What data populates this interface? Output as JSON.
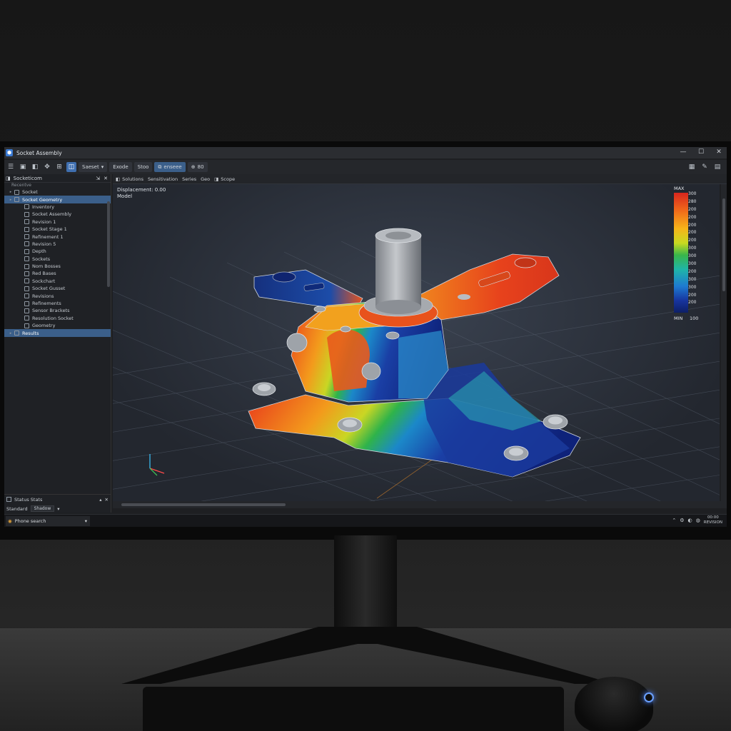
{
  "app": {
    "title": "Socket Assembly",
    "logo_glyph": "⬢",
    "window_controls": [
      "—",
      "☐",
      "✕"
    ]
  },
  "toolbar": {
    "icons": [
      "menu-icon",
      "save-icon",
      "open-icon",
      "settings-icon",
      "view-icon"
    ],
    "buttons": [
      {
        "label": "Saeset"
      },
      {
        "label": "Exode"
      },
      {
        "label": "Stoo"
      },
      {
        "label": "enseee"
      },
      {
        "label": "80"
      }
    ],
    "right_icons": [
      "grid-icon",
      "pen-icon",
      "table-icon"
    ]
  },
  "sidebar": {
    "header": "Socketicom",
    "search": "Recentve",
    "tree": [
      {
        "label": "Socket",
        "level": 1,
        "selected": false
      },
      {
        "label": "Socket Geometry",
        "level": 1,
        "selected": true
      },
      {
        "label": "Inventory",
        "level": 2,
        "selected": false
      },
      {
        "label": "Socket Assembly",
        "level": 2,
        "selected": false
      },
      {
        "label": "Revision 1",
        "level": 2,
        "selected": false
      },
      {
        "label": "Socket Stage 1",
        "level": 2,
        "selected": false
      },
      {
        "label": "Refinement 1",
        "level": 2,
        "selected": false
      },
      {
        "label": "Revision 5",
        "level": 2,
        "selected": false
      },
      {
        "label": "Depth",
        "level": 2,
        "selected": false
      },
      {
        "label": "Sockets",
        "level": 2,
        "selected": false
      },
      {
        "label": "Nom Bosses",
        "level": 2,
        "selected": false
      },
      {
        "label": "Red Bases",
        "level": 2,
        "selected": false
      },
      {
        "label": "Sockchart",
        "level": 2,
        "selected": false
      },
      {
        "label": "Socket Gusset",
        "level": 2,
        "selected": false
      },
      {
        "label": "Revisions",
        "level": 2,
        "selected": false
      },
      {
        "label": "Refinements",
        "level": 2,
        "selected": false
      },
      {
        "label": "Sensor Brackets",
        "level": 2,
        "selected": false
      },
      {
        "label": "Resolution Socket",
        "level": 2,
        "selected": false
      },
      {
        "label": "Geometry",
        "level": 2,
        "selected": false
      },
      {
        "label": "Results",
        "level": 1,
        "selected": true
      }
    ],
    "bottom": {
      "section_label": "Status Stats",
      "field_label": "Standard",
      "field_value": "Shadow"
    }
  },
  "view_tabs": [
    "Solutions",
    "Sensitivation",
    "Series",
    "Geo",
    "Scope"
  ],
  "viewport": {
    "info_line1": "Displacement: 0.00",
    "info_line2": "Model",
    "legend": {
      "max_label": "MAX",
      "min_label": "MIN",
      "min_value": "100",
      "ticks": [
        "300",
        "280",
        "200",
        "200",
        "200",
        "200",
        "200",
        "300",
        "300",
        "300",
        "200",
        "300",
        "300",
        "200",
        "200"
      ],
      "colors": [
        "#d7261e",
        "#f6b519",
        "#39b54a",
        "#1e7ad1",
        "#0d1f66"
      ]
    }
  },
  "taskbar": {
    "app_label": "Phone search",
    "clock_line1": "00:00",
    "clock_line2": "REVISION"
  }
}
